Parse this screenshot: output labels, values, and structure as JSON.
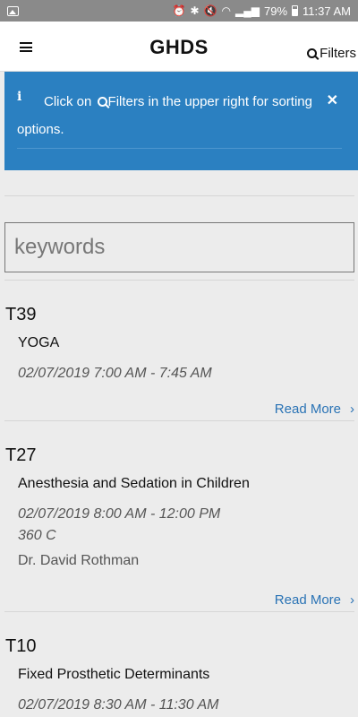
{
  "status_bar": {
    "battery": "79%",
    "time": "11:37 AM"
  },
  "header": {
    "title": "GHDS",
    "filters_label": "Filters"
  },
  "alert": {
    "message_part1": "Click on ",
    "message_part2": "Filters in the upper right for sorting options."
  },
  "search": {
    "placeholder": "keywords"
  },
  "events": [
    {
      "code": "T39",
      "title": "YOGA",
      "time": "02/07/2019 7:00 AM - 7:45 AM",
      "read_more": "Read More"
    },
    {
      "code": "T27",
      "title": "Anesthesia and Sedation in Children",
      "time": "02/07/2019 8:00 AM - 12:00 PM",
      "room": "360 C",
      "speaker": "Dr. David Rothman",
      "read_more": "Read More"
    },
    {
      "code": "T10",
      "title": "Fixed Prosthetic Determinants",
      "time": "02/07/2019 8:30 AM - 11:30 AM"
    }
  ]
}
